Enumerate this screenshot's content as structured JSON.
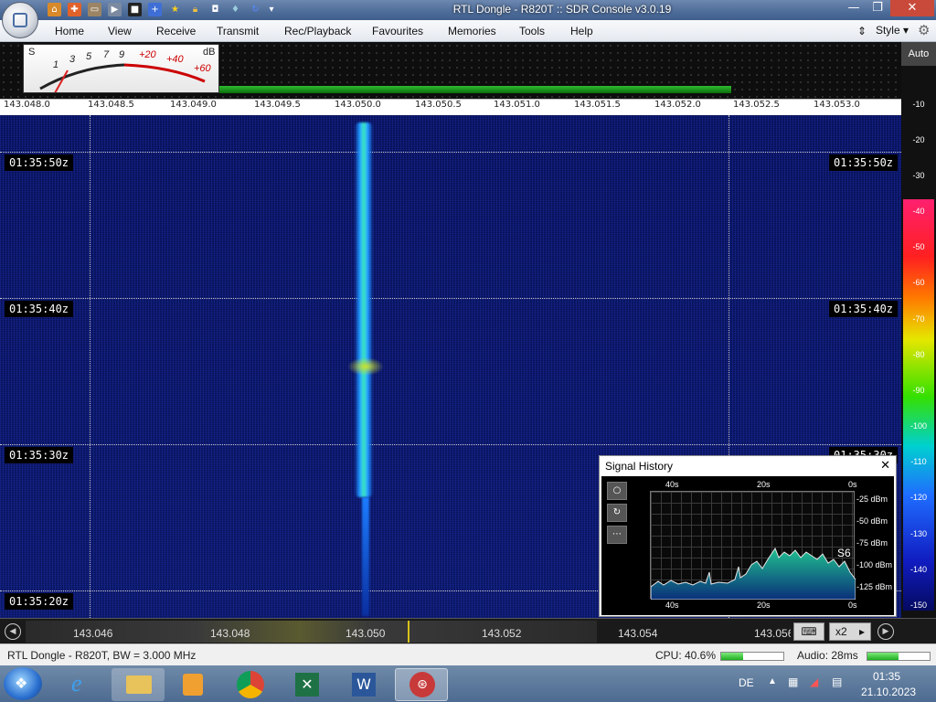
{
  "window": {
    "title": "RTL Dongle - R820T :: SDR Console v3.0.19",
    "minimize": "—",
    "maximize": "❐",
    "close": "✕"
  },
  "ribbon": {
    "tabs": [
      "Home",
      "View",
      "Receive",
      "Transmit",
      "Rec/Playback",
      "Favourites",
      "Memories",
      "Tools",
      "Help"
    ],
    "style": "Style"
  },
  "smeter": {
    "s_label": "S",
    "db_label": "dB",
    "scale_s": [
      "1",
      "3",
      "5",
      "7",
      "9"
    ],
    "scale_db": [
      "+20",
      "+40",
      "+60"
    ]
  },
  "spectrum": {
    "auto": "Auto",
    "freq_ticks": [
      "143.048.0",
      "143.048.5",
      "143.049.0",
      "143.049.5",
      "143.050.0",
      "143.050.5",
      "143.051.0",
      "143.051.5",
      "143.052.0",
      "143.052.5",
      "143.053.0"
    ]
  },
  "scale": {
    "labels": [
      "-10",
      "-20",
      "-30",
      "-40",
      "-50",
      "-60",
      "-70",
      "-80",
      "-90",
      "-100",
      "-110",
      "-120",
      "-130",
      "-140",
      "-150"
    ]
  },
  "waterfall": {
    "times": [
      "01:35:50z",
      "01:35:40z",
      "01:35:30z",
      "01:35:20z"
    ]
  },
  "tuner": {
    "freqs": [
      "143.046",
      "143.048",
      "143.050",
      "143.052",
      "143.054",
      "143.056"
    ],
    "zoom": "x2"
  },
  "status": {
    "device": "RTL Dongle - R820T, BW = 3.000 MHz",
    "cpu": "CPU: 40.6%",
    "cpu_level": 0.35,
    "audio": "Audio: 28ms",
    "audio_level": 0.5
  },
  "signal_history": {
    "title": "Signal History",
    "close": "✕",
    "top_axis": [
      "40s",
      "20s",
      "0s"
    ],
    "bottom_axis": [
      "40s",
      "20s",
      "0s"
    ],
    "y_axis": [
      "-25 dBm",
      "-50 dBm",
      "-75 dBm",
      "-100 dBm",
      "-125 dBm"
    ],
    "current": "S6"
  },
  "taskbar": {
    "lang": "DE",
    "time": "01:35",
    "date": "21.10.2023"
  }
}
